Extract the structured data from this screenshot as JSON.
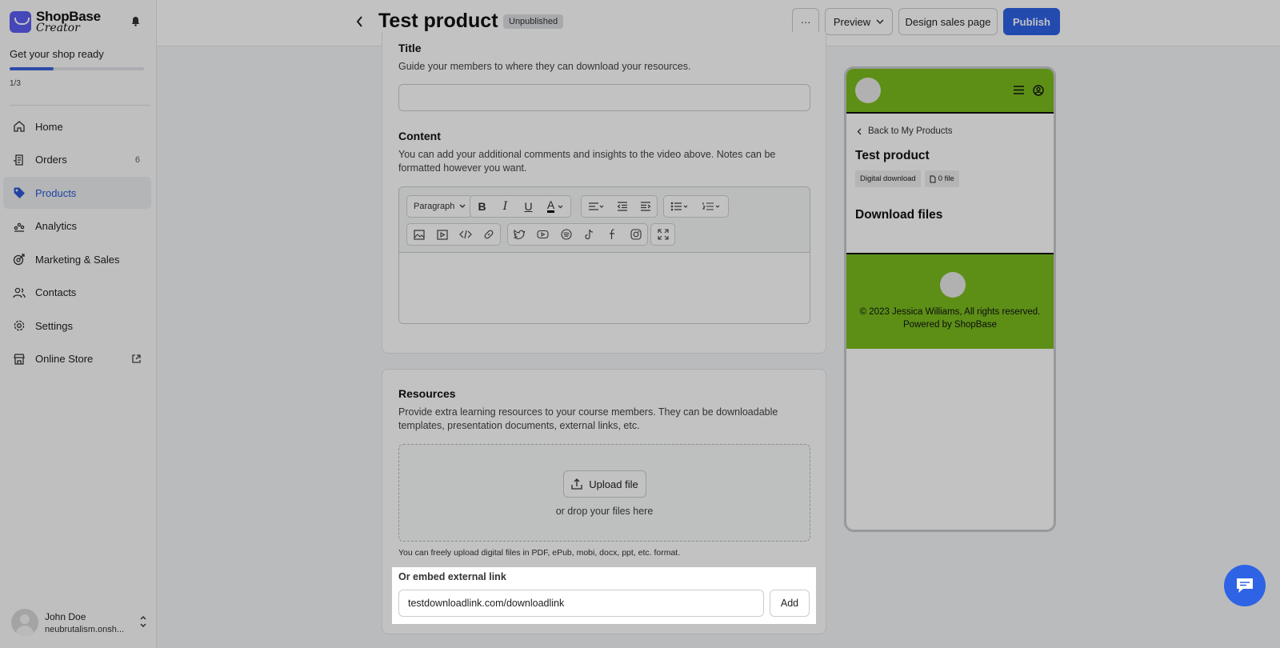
{
  "sidebar": {
    "brand": "ShopBase",
    "brand_sub": "Creator",
    "ready_text": "Get your shop ready",
    "progress_count": "1/3",
    "progress_fraction": 0.33,
    "nav": [
      {
        "label": "Home",
        "icon": "home-icon"
      },
      {
        "label": "Orders",
        "icon": "orders-icon",
        "badge": "6"
      },
      {
        "label": "Products",
        "icon": "tag-icon",
        "active": true
      },
      {
        "label": "Analytics",
        "icon": "analytics-icon"
      },
      {
        "label": "Marketing & Sales",
        "icon": "marketing-icon"
      },
      {
        "label": "Contacts",
        "icon": "contacts-icon"
      },
      {
        "label": "Settings",
        "icon": "gear-icon"
      },
      {
        "label": "Online Store",
        "icon": "store-icon"
      }
    ],
    "user": {
      "name": "John Doe",
      "store": "neubrutalism.onsh..."
    }
  },
  "topbar": {
    "title": "Test product",
    "status": "Unpublished",
    "more_label": "···",
    "preview_label": "Preview",
    "design_label": "Design sales page",
    "publish_label": "Publish"
  },
  "title_section": {
    "label": "Title",
    "description": "Guide your members to where they can download your resources.",
    "value": ""
  },
  "content_section": {
    "label": "Content",
    "description": "You can add your additional comments and insights to the video above. Notes can be formatted however you want.",
    "paragraph_label": "Paragraph"
  },
  "resources": {
    "label": "Resources",
    "description": "Provide extra learning resources to your course members. They can be downloadable templates, presentation documents, external links, etc.",
    "upload_label": "Upload file",
    "drop_text": "or drop your files here",
    "formats_note": "You can freely upload digital files in PDF, ePub, mobi, docx, ppt, etc. format.",
    "embed_label": "Or embed external link",
    "embed_value": "testdownloadlink.com/downloadlink",
    "add_label": "Add"
  },
  "preview": {
    "back_label": "Back to My Products",
    "product_title": "Test product",
    "tag_type": "Digital download",
    "tag_files": "0 file",
    "section_title": "Download files",
    "copyright": "© 2023 Jessica Williams, All rights reserved.",
    "powered": "Powered by ShopBase",
    "brand_color": "#7bbd1f"
  },
  "colors": {
    "accent": "#2e63e6",
    "active_nav": "#2d58d6"
  }
}
